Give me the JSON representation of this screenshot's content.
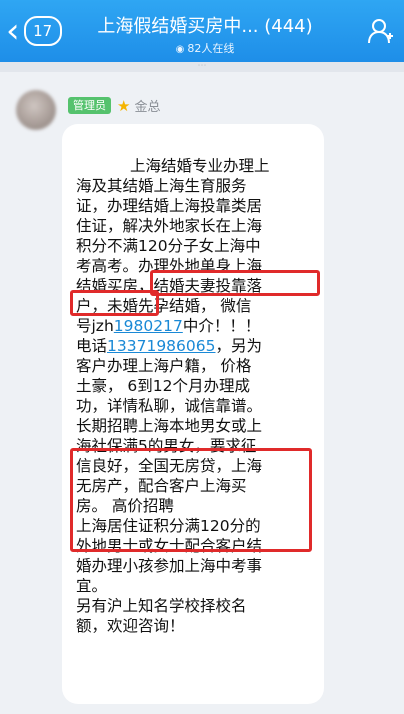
{
  "header": {
    "back_count": "17",
    "title": "上海假结婚买房中... (444)",
    "online": "82人在线"
  },
  "message": {
    "role": "管理员",
    "sender": "金总",
    "lines": [
      {
        "segments": [
          {
            "text": "上海结婚专业办理上"
          }
        ],
        "indent": 54
      },
      {
        "segments": [
          {
            "text": "海及其结婚上海生育服务"
          }
        ]
      },
      {
        "segments": [
          {
            "text": "证，办理结婚上海投靠类居"
          }
        ]
      },
      {
        "segments": [
          {
            "text": "住证，解决外地家长在上海"
          }
        ]
      },
      {
        "segments": [
          {
            "text": "积分不满120分子女上海中"
          }
        ]
      },
      {
        "segments": [
          {
            "text": "考高考。办理外地单身上海"
          }
        ]
      },
      {
        "segments": [
          {
            "text": "结婚买房，结婚夫妻投靠落"
          }
        ]
      },
      {
        "segments": [
          {
            "text": "户，未婚先孕结婚， 微信"
          }
        ]
      },
      {
        "segments": [
          {
            "text": "号jzh"
          },
          {
            "text": "1980217",
            "link": true
          },
          {
            "text": "中介！！！"
          }
        ]
      },
      {
        "segments": [
          {
            "text": "电话"
          },
          {
            "text": "13371986065",
            "link": true
          },
          {
            "text": "，另为"
          }
        ]
      },
      {
        "segments": [
          {
            "text": "客户办理上海户籍， 价格"
          }
        ]
      },
      {
        "segments": [
          {
            "text": "土豪， 6到12个月办理成"
          }
        ]
      },
      {
        "segments": [
          {
            "text": "功，详情私聊，诚信靠谱。"
          }
        ]
      },
      {
        "segments": [
          {
            "text": "长期招聘上海本地男女或上"
          }
        ]
      },
      {
        "segments": [
          {
            "text": "海社保满5的男女，要求征"
          }
        ]
      },
      {
        "segments": [
          {
            "text": "信良好，全国无房贷，上海"
          }
        ]
      },
      {
        "segments": [
          {
            "text": "无房产，配合客户上海买"
          }
        ]
      },
      {
        "segments": [
          {
            "text": "房。          高价招聘"
          }
        ]
      },
      {
        "segments": [
          {
            "text": "上海居住证积分满120分的"
          }
        ]
      },
      {
        "segments": [
          {
            "text": "外地男士或女士配合客户结"
          }
        ]
      },
      {
        "segments": [
          {
            "text": "婚办理小孩参加上海中考事"
          }
        ]
      },
      {
        "segments": [
          {
            "text": "宜。"
          }
        ]
      },
      {
        "segments": [
          {
            "text": "另有沪上知名学校择校名"
          }
        ]
      },
      {
        "segments": [
          {
            "text": "额，欢迎咨询！"
          }
        ]
      }
    ]
  },
  "colors": {
    "topbar": "#1e8ee8",
    "badge_green": "#55c26d",
    "highlight_red": "#e02a2a",
    "link": "#1a89d6"
  },
  "icons": [
    "chevron-left-icon",
    "eye-icon",
    "members-icon",
    "star-icon"
  ]
}
